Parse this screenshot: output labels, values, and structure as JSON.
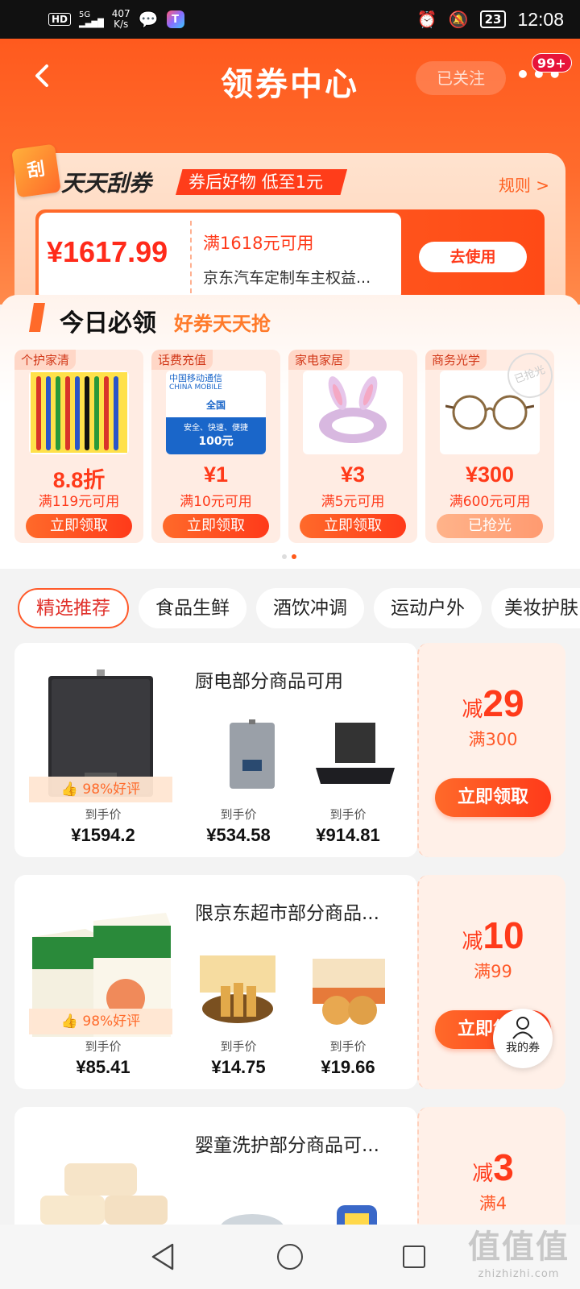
{
  "status_bar": {
    "hd": "HD",
    "net": "5G",
    "speed_value": "407",
    "speed_unit": "K/s",
    "battery": "23",
    "time": "12:08"
  },
  "nav": {
    "title": "领券中心",
    "follow_label": "已关注",
    "notification_count": "99+"
  },
  "scratch": {
    "title": "天天刮券",
    "tag": "券后好物 低至1元",
    "rules": "规则 >",
    "icon_text": "刮",
    "coupon": {
      "amount": "¥1617.99",
      "condition": "满1618元可用",
      "desc": "京东汽车定制车主权益...",
      "button": "去使用"
    }
  },
  "today": {
    "title": "今日必领",
    "subtitle": "好券天天抢",
    "items": [
      {
        "category": "个护家清",
        "price": "8.8折",
        "condition": "满119元可用",
        "button": "立即领取",
        "claimed": false
      },
      {
        "category": "话费充值",
        "price": "¥1",
        "condition": "满10元可用",
        "button": "立即领取",
        "claimed": false,
        "card_lines": [
          "中国移动通信",
          "CHINA MOBILE",
          "全国",
          "安全、快速、便捷",
          "100元"
        ]
      },
      {
        "category": "家电家居",
        "price": "¥3",
        "condition": "满5元可用",
        "button": "立即领取",
        "claimed": false
      },
      {
        "category": "商务光学",
        "price": "¥300",
        "condition": "满600元可用",
        "button": "已抢光",
        "claimed": true,
        "stamp": "已抢光"
      }
    ]
  },
  "tabs": [
    "精选推荐",
    "食品生鲜",
    "酒饮冲调",
    "运动户外",
    "美妆护肤"
  ],
  "cards": [
    {
      "title": "厨电部分商品可用",
      "rating": "98%好评",
      "products": [
        {
          "label": "到手价",
          "price": "¥1594.2"
        },
        {
          "label": "到手价",
          "price": "¥534.58"
        },
        {
          "label": "到手价",
          "price": "¥914.81"
        }
      ],
      "discount_prefix": "减",
      "discount": "29",
      "threshold": "满300",
      "button": "立即领取"
    },
    {
      "title": "限京东超市部分商品...",
      "rating": "98%好评",
      "products": [
        {
          "label": "到手价",
          "price": "¥85.41"
        },
        {
          "label": "到手价",
          "price": "¥14.75"
        },
        {
          "label": "到手价",
          "price": "¥19.66"
        }
      ],
      "discount_prefix": "减",
      "discount": "10",
      "threshold": "满99",
      "button": "立即领取"
    },
    {
      "title": "婴童洗护部分商品可...",
      "discount_prefix": "减",
      "discount": "3",
      "threshold": "满4"
    }
  ],
  "float": {
    "my_coupon": "我的券"
  },
  "watermark": {
    "big": "值值值",
    "small": "zhizhizhi.com"
  },
  "colors": {
    "brand": "#ff5a1e",
    "accent_red": "#ff3a1a"
  }
}
